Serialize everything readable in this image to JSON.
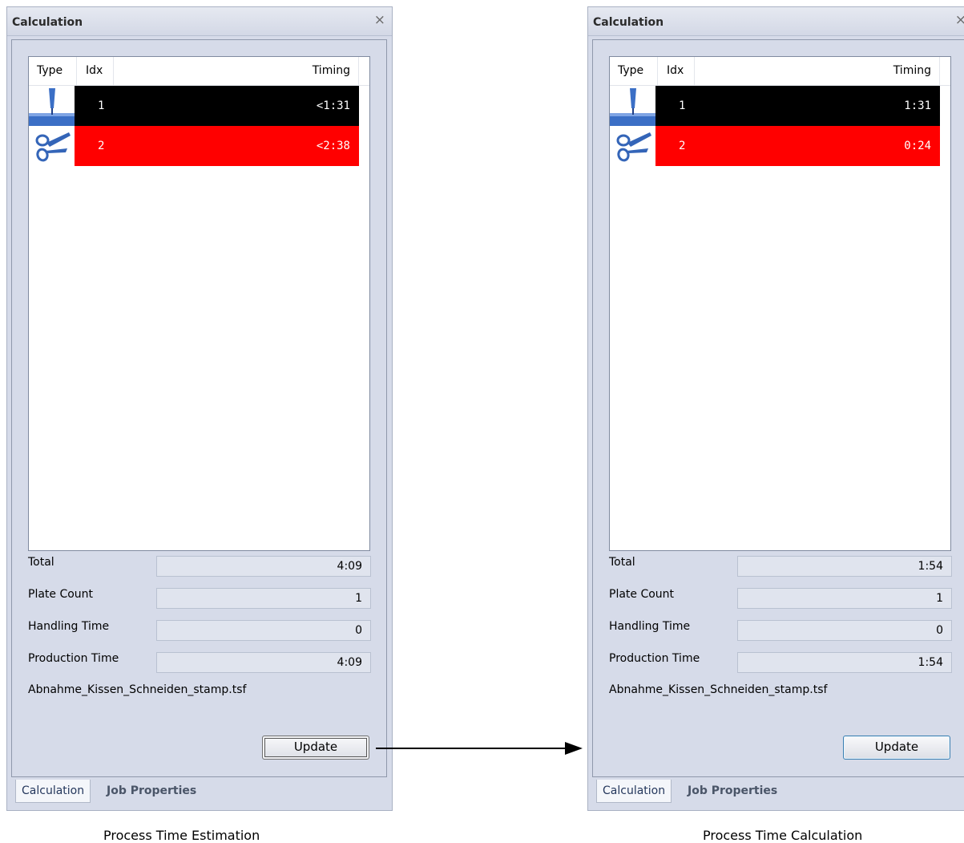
{
  "panels": [
    {
      "title": "Calculation",
      "columns": {
        "type": "Type",
        "idx": "Idx",
        "timing": "Timing"
      },
      "rows": [
        {
          "icon": "stamp-icon",
          "idx": "1",
          "timing": "<1:31",
          "color": "#000000"
        },
        {
          "icon": "scissors-icon",
          "idx": "2",
          "timing": "<2:38",
          "color": "#ff0000"
        }
      ],
      "fields": {
        "total_label": "Total",
        "total_value": "4:09",
        "plate_count_label": "Plate Count",
        "plate_count_value": "1",
        "handling_time_label": "Handling Time",
        "handling_time_value": "0",
        "production_time_label": "Production Time",
        "production_time_value": "4:09"
      },
      "filename": "Abnahme_Kissen_Schneiden_stamp.tsf",
      "update_label": "Update",
      "tabs": [
        "Calculation",
        "Job Properties"
      ]
    },
    {
      "title": "Calculation",
      "columns": {
        "type": "Type",
        "idx": "Idx",
        "timing": "Timing"
      },
      "rows": [
        {
          "icon": "stamp-icon",
          "idx": "1",
          "timing": "1:31",
          "color": "#000000"
        },
        {
          "icon": "scissors-icon",
          "idx": "2",
          "timing": "0:24",
          "color": "#ff0000"
        }
      ],
      "fields": {
        "total_label": "Total",
        "total_value": "1:54",
        "plate_count_label": "Plate Count",
        "plate_count_value": "1",
        "handling_time_label": "Handling Time",
        "handling_time_value": "0",
        "production_time_label": "Production Time",
        "production_time_value": "1:54"
      },
      "filename": "Abnahme_Kissen_Schneiden_stamp.tsf",
      "update_label": "Update",
      "tabs": [
        "Calculation",
        "Job Properties"
      ]
    }
  ],
  "captions": {
    "left": "Process Time Estimation",
    "right": "Process Time Calculation"
  },
  "close_glyph": "×"
}
